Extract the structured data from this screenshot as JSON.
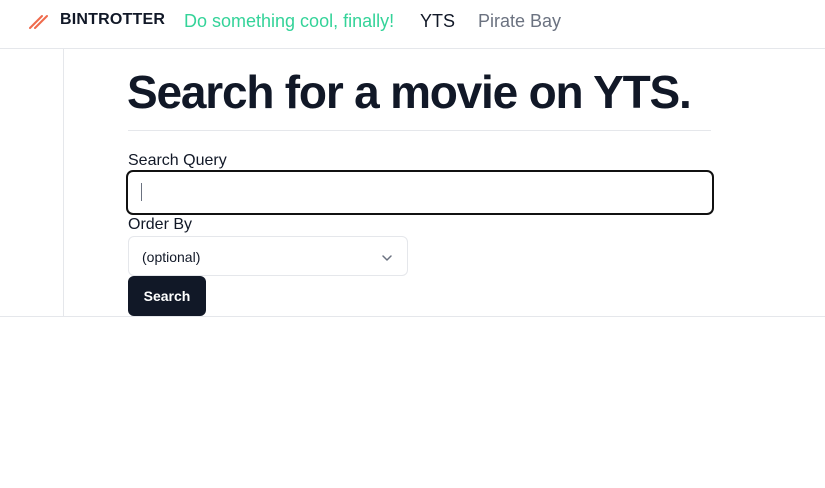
{
  "header": {
    "brand": "BINTROTTER",
    "brand_icon": "slash-logo-icon",
    "brand_color": "#ef6a4c",
    "tagline": "Do something cool, finally!",
    "tagline_color": "#34d399",
    "nav": [
      {
        "label": "YTS",
        "active": true
      },
      {
        "label": "Pirate Bay",
        "active": false
      }
    ]
  },
  "main": {
    "title": "Search for a movie on YTS.",
    "query_label": "Search Query",
    "query_value": "",
    "order_label": "Order By",
    "order_selected": "(optional)",
    "submit_label": "Search",
    "submit_color": "#111827"
  }
}
